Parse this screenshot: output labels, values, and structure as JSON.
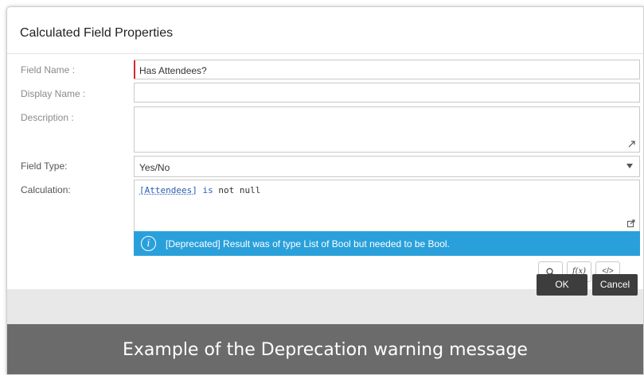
{
  "dialog": {
    "title": "Calculated Field Properties"
  },
  "form": {
    "field_name_label": "Field Name :",
    "field_name_value": "Has Attendees?",
    "display_name_label": "Display Name :",
    "display_name_value": "",
    "description_label": "Description :",
    "description_value": "",
    "field_type_label": "Field Type:",
    "field_type_value": "Yes/No",
    "calculation_label": "Calculation:",
    "calculation": {
      "field_token": "[Attendees]",
      "operator": "is",
      "rest": "not null"
    }
  },
  "warning": {
    "icon": "info-icon",
    "message": "[Deprecated] Result was of type List of Bool but needed to be Bool."
  },
  "toolbar": {
    "search_icon": "search-icon",
    "function_label": "f(x)",
    "code_label": "</>"
  },
  "buttons": {
    "ok": "OK",
    "cancel": "Cancel"
  },
  "caption": "Example of the Deprecation warning message",
  "colors": {
    "warning_bg": "#2aa0db",
    "required_marker": "#d9262e",
    "button_bg": "#3d3d3d",
    "caption_bg": "#6b6b6b"
  }
}
